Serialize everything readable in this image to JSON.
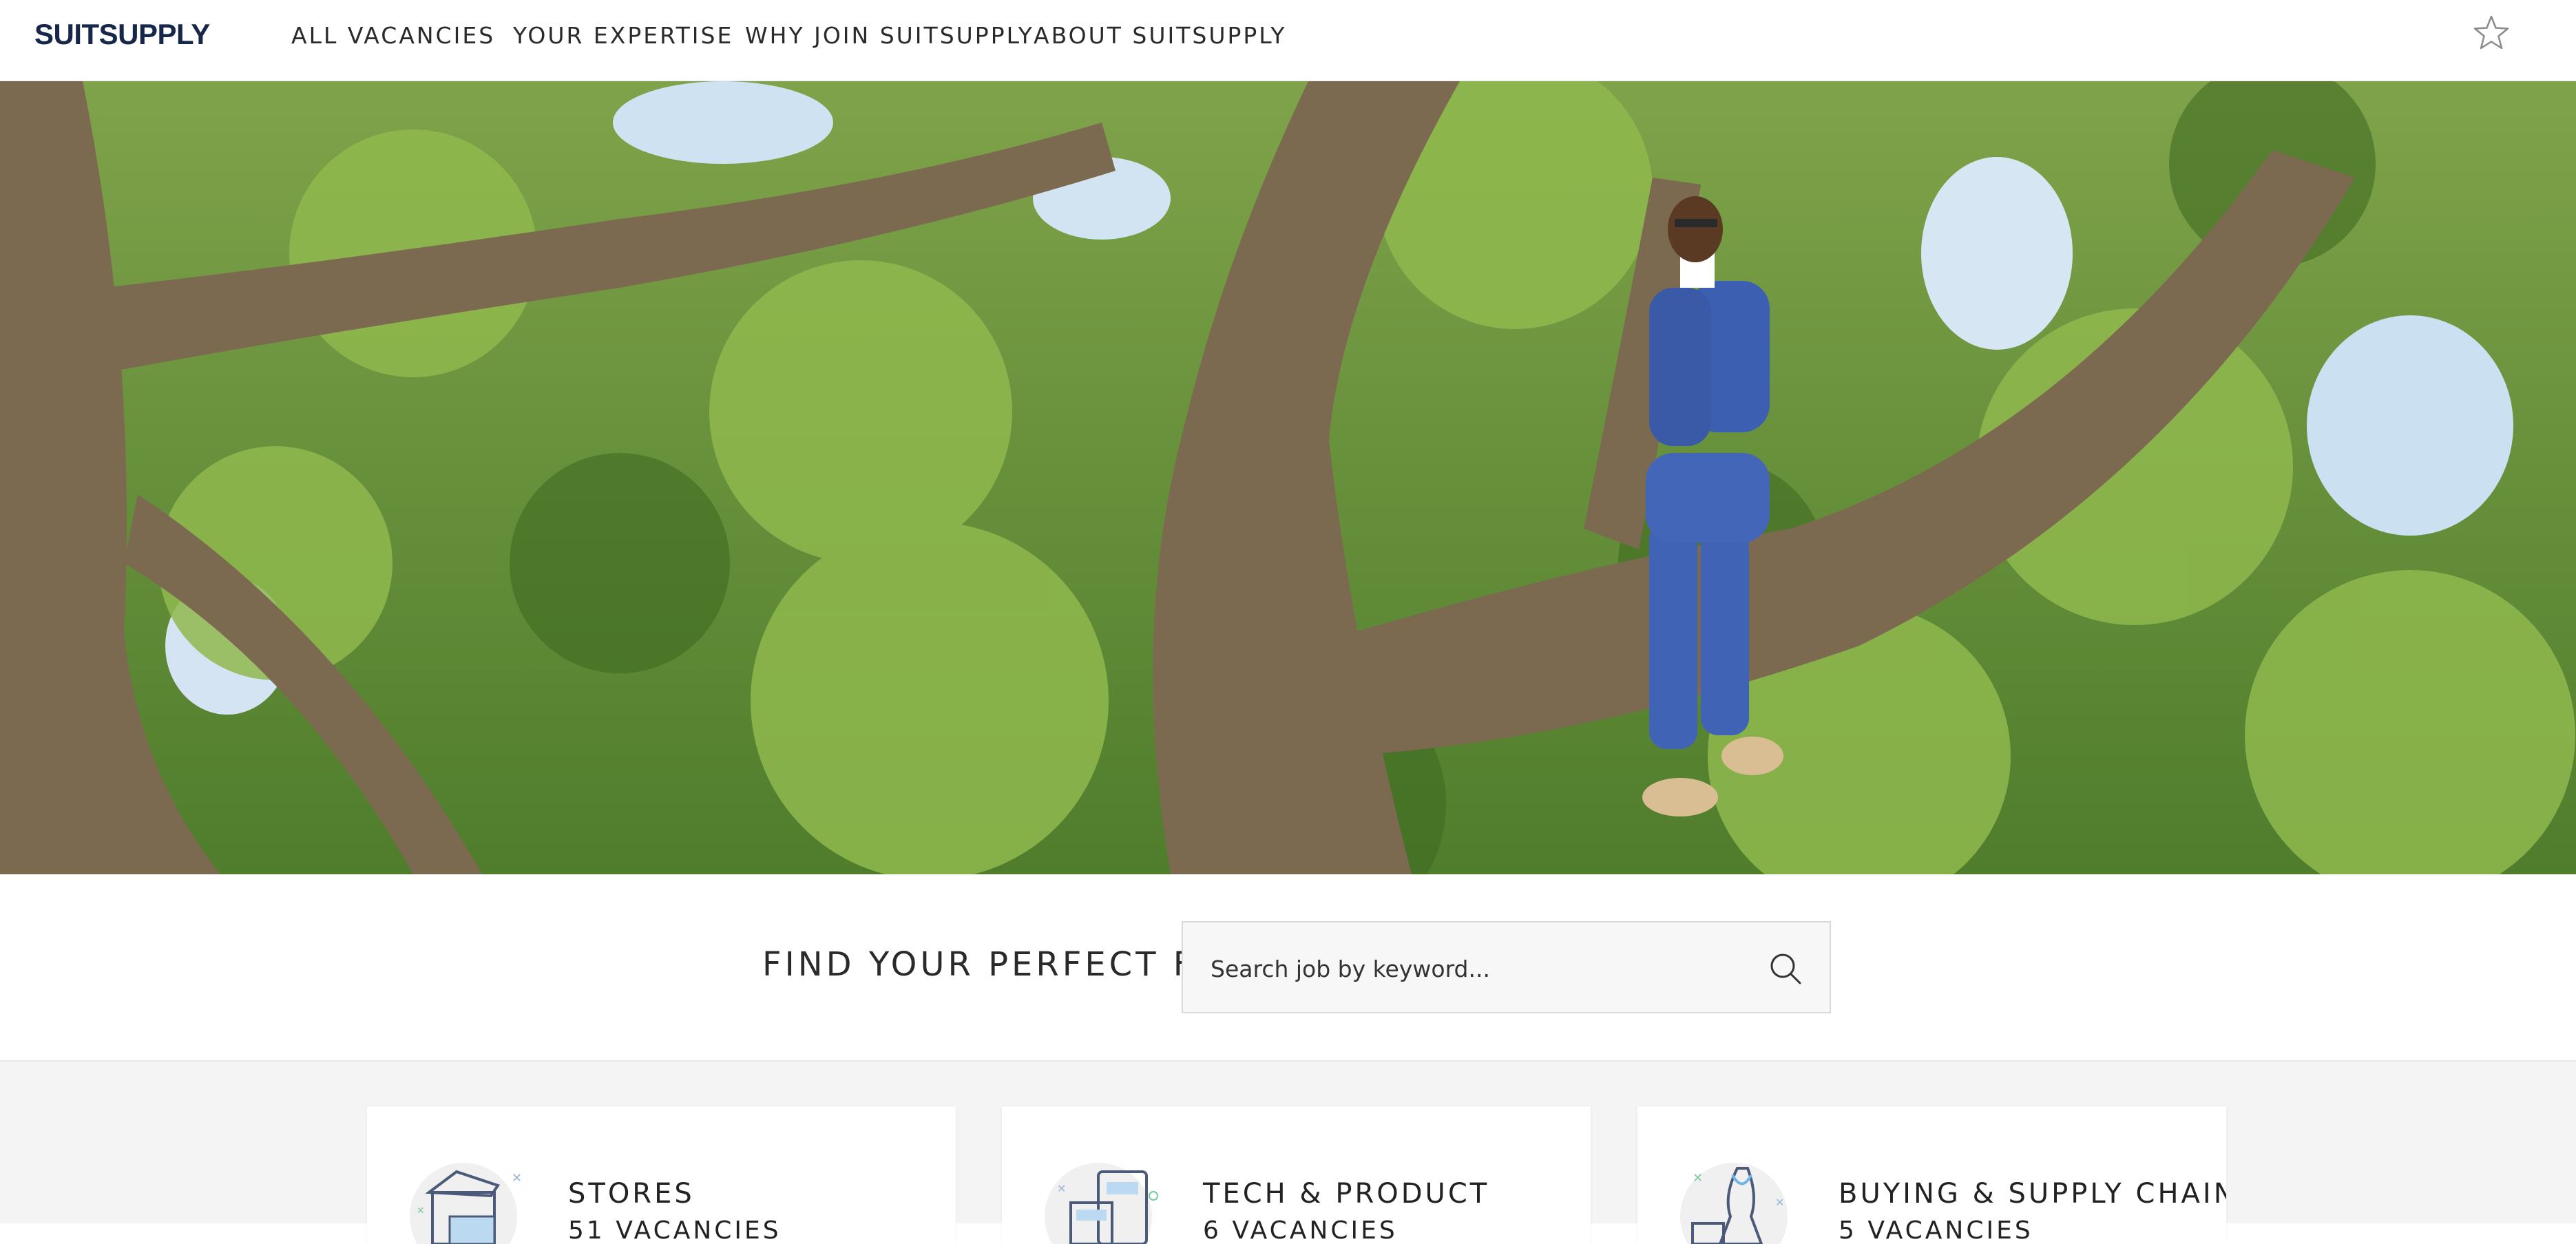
{
  "brand": {
    "logo": "SUITSUPPLY",
    "color": "#16274a"
  },
  "nav": {
    "items": [
      {
        "label": "ALL VACANCIES"
      },
      {
        "label": "YOUR EXPERTISE"
      },
      {
        "label": "WHY JOIN SUITSUPPLY"
      },
      {
        "label": "ABOUT SUITSUPPLY"
      }
    ],
    "favorite_icon": "star-icon"
  },
  "hero": {
    "image": "man-in-blue-suit-sitting-in-tree"
  },
  "search": {
    "title": "FIND YOUR PERFECT FIT",
    "placeholder": "Search job by keyword...",
    "icon": "search-icon"
  },
  "categories": [
    {
      "title": "STORES",
      "subtitle": "51 VACANCIES",
      "icon": "store-icon"
    },
    {
      "title": "TECH & PRODUCT",
      "subtitle": "6 VACANCIES",
      "icon": "devices-icon"
    },
    {
      "title": "BUYING & SUPPLY CHAIN",
      "subtitle": "5 VACANCIES",
      "icon": "mannequin-icon"
    }
  ]
}
